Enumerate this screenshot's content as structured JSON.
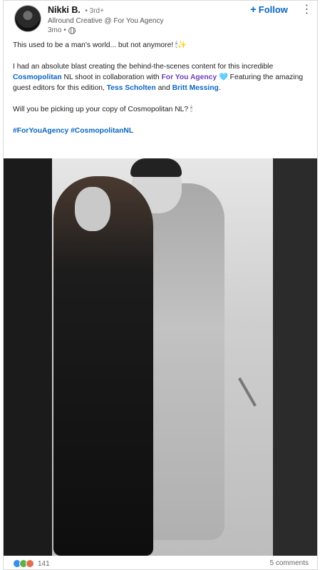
{
  "author": {
    "name": "Nikki B.",
    "degree": "• 3rd+",
    "headline": "Allround Creative @ For You Agency",
    "time": "3mo •"
  },
  "actions": {
    "follow_label": "Follow",
    "more_label": "⋮"
  },
  "post": {
    "line1": "This used to be a man's world... but not anymore! 🕯✨",
    "p2_part1": "I had an absolute blast creating the behind-the-scenes content for this incredible ",
    "p2_link1": "Cosmopolitan",
    "p2_part2": " NL shoot in collaboration with ",
    "p2_link2": "For You Agency",
    "p2_part3": " 🩵 Featuring the amazing guest editors for this edition, ",
    "p2_link3": "Tess Scholten",
    "p2_part4": " and ",
    "p2_link4": "Britt Messing",
    "p2_part5": ".",
    "question": "Will you be picking up your copy of Cosmopolitan NL? 🕯",
    "hashtags": "#ForYouAgency #CosmopolitanNL"
  },
  "social": {
    "reaction_count": "141",
    "comments": "5 comments"
  },
  "icons": {
    "reactions": [
      "like-icon",
      "celebrate-icon",
      "love-icon"
    ],
    "privacy": "globe-icon"
  }
}
